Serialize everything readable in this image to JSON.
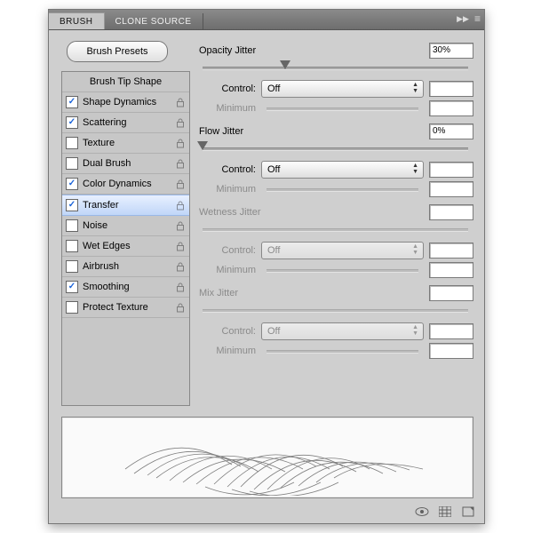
{
  "tabs": {
    "brush": "BRUSH",
    "clone": "CLONE SOURCE"
  },
  "brush_presets_btn": "Brush Presets",
  "options": {
    "header": "Brush Tip Shape",
    "items": [
      {
        "label": "Shape Dynamics",
        "checked": true,
        "lock": true
      },
      {
        "label": "Scattering",
        "checked": true,
        "lock": true
      },
      {
        "label": "Texture",
        "checked": false,
        "lock": true
      },
      {
        "label": "Dual Brush",
        "checked": false,
        "lock": true
      },
      {
        "label": "Color Dynamics",
        "checked": true,
        "lock": true
      },
      {
        "label": "Transfer",
        "checked": true,
        "lock": true
      },
      {
        "label": "Noise",
        "checked": false,
        "lock": true
      },
      {
        "label": "Wet Edges",
        "checked": false,
        "lock": true
      },
      {
        "label": "Airbrush",
        "checked": false,
        "lock": true
      },
      {
        "label": "Smoothing",
        "checked": true,
        "lock": true
      },
      {
        "label": "Protect Texture",
        "checked": false,
        "lock": true
      }
    ],
    "selected_index": 5
  },
  "settings": {
    "opacity": {
      "title": "Opacity Jitter",
      "value": "30%",
      "control_label": "Control:",
      "control_value": "Off",
      "min_label": "Minimum",
      "thumb_pct": 30
    },
    "flow": {
      "title": "Flow Jitter",
      "value": "0%",
      "control_label": "Control:",
      "control_value": "Off",
      "min_label": "Minimum",
      "thumb_pct": 0
    },
    "wetness": {
      "title": "Wetness Jitter",
      "value": "",
      "control_label": "Control:",
      "control_value": "Off",
      "min_label": "Minimum"
    },
    "mix": {
      "title": "Mix Jitter",
      "value": "",
      "control_label": "Control:",
      "control_value": "Off",
      "min_label": "Minimum"
    }
  }
}
